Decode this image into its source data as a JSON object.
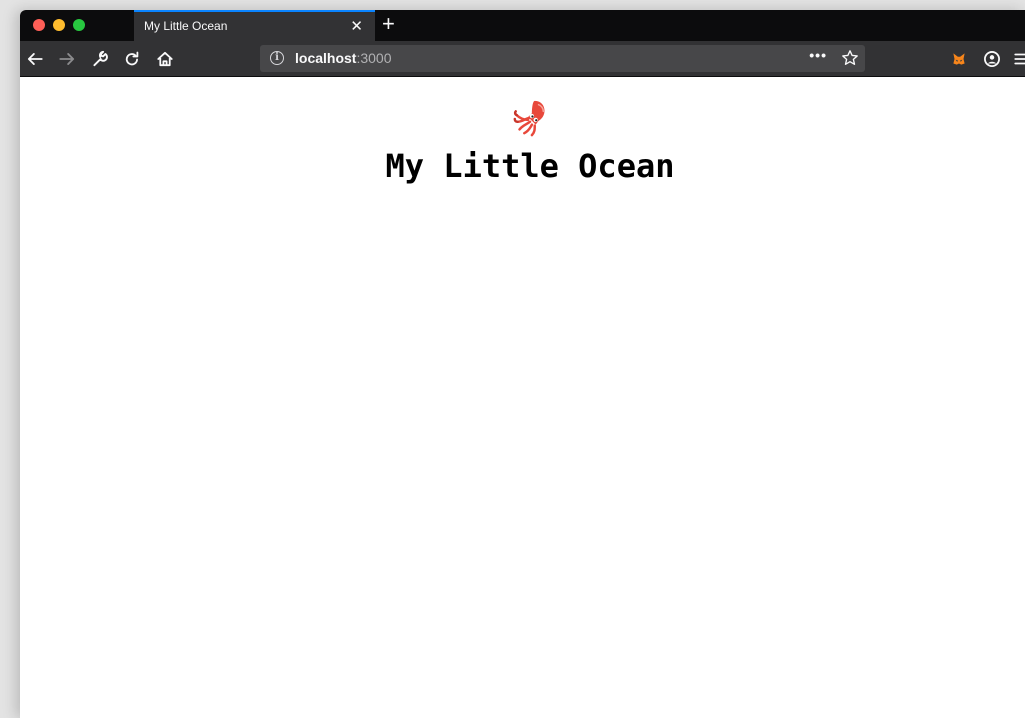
{
  "browser": {
    "tab": {
      "title": "My Little Ocean",
      "close_label": "✕"
    },
    "new_tab_label": "+",
    "url": {
      "host": "localhost",
      "port": ":3000"
    },
    "page_actions_label": "•••"
  },
  "page": {
    "emoji": "squid-icon",
    "heading": "My Little Ocean"
  },
  "colors": {
    "tab_accent": "#0a84ff",
    "chrome_dark": "#0c0c0d",
    "toolbar": "#323234",
    "urlbar": "#474749"
  }
}
